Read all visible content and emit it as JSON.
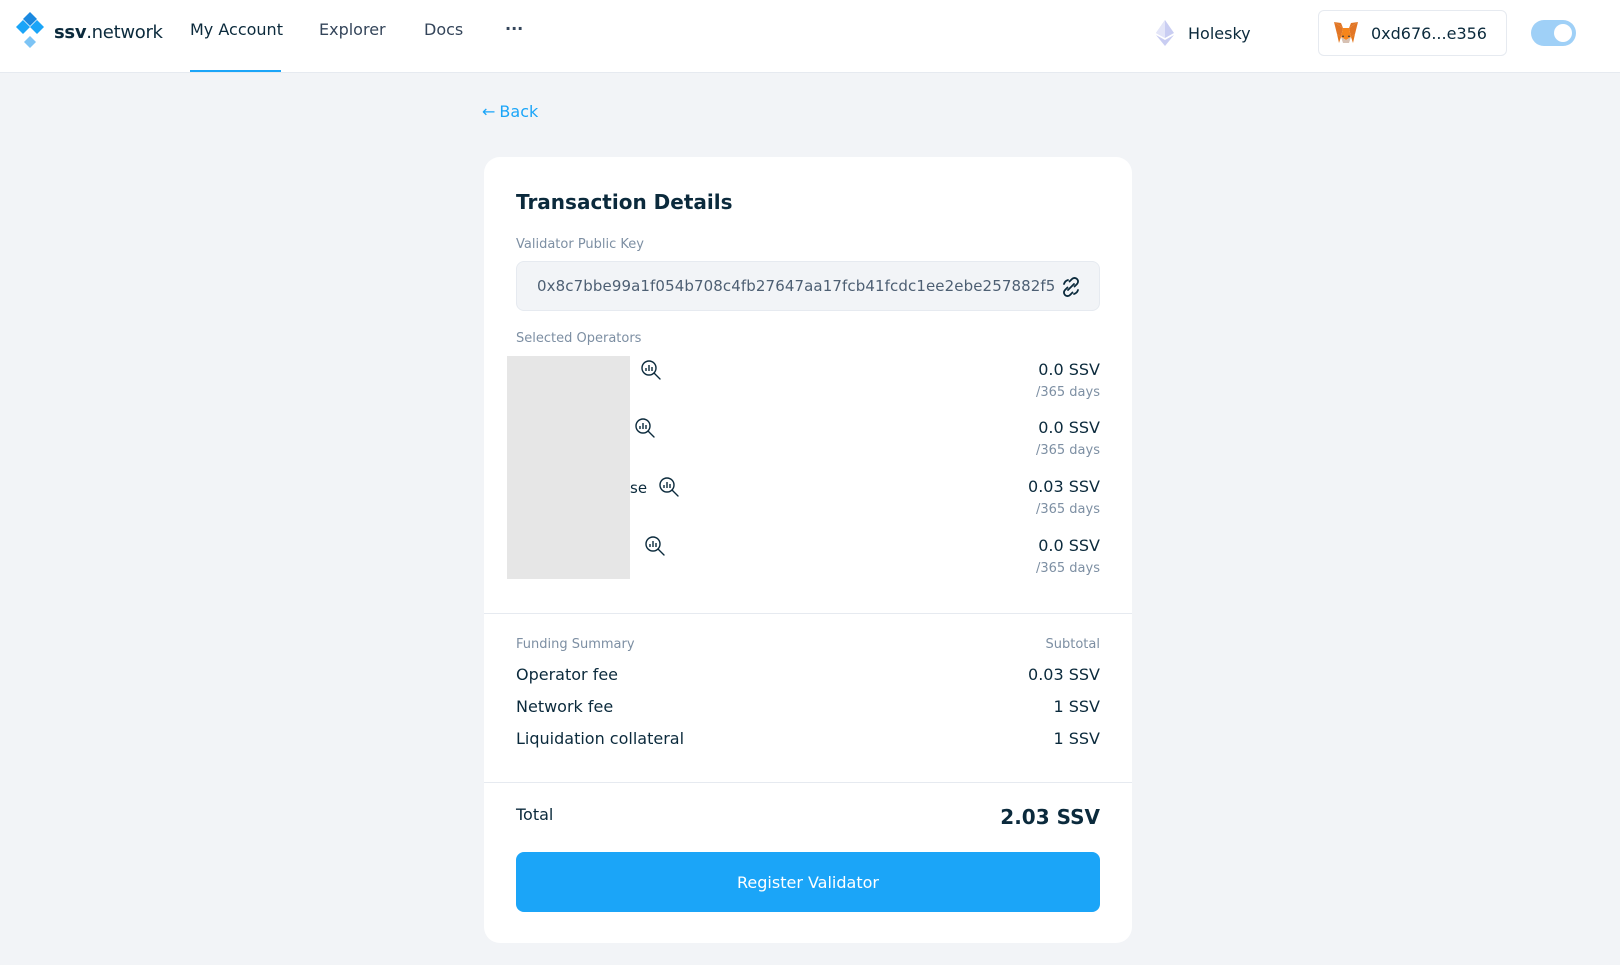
{
  "header": {
    "logo_bold": "ssv",
    "logo_rest": ".network",
    "nav": [
      {
        "label": "My Account",
        "active": true
      },
      {
        "label": "Explorer",
        "active": false
      },
      {
        "label": "Docs",
        "active": false
      },
      {
        "label": "···",
        "active": false
      }
    ],
    "network": {
      "label": "Holesky",
      "icon": "ethereum-icon"
    },
    "wallet": {
      "address": "0xd676...e356",
      "icon": "metamask-fox-icon"
    },
    "theme_toggle": {
      "on": true
    }
  },
  "back_label": "Back",
  "card": {
    "title": "Transaction Details",
    "pubkey_label": "Validator Public Key",
    "pubkey_value": "0x8c7bbe99a1f054b708c4fb27647aa17fcb41fcdc1ee2ebe257882f5",
    "operators_label": "Selected Operators",
    "operators": [
      {
        "name_visible": "",
        "fee": "0.0 SSV",
        "period": "/365 days"
      },
      {
        "name_visible": "",
        "fee": "0.0 SSV",
        "period": "/365 days"
      },
      {
        "name_visible": "se",
        "fee": "0.03 SSV",
        "period": "/365 days"
      },
      {
        "name_visible": "",
        "fee": "0.0 SSV",
        "period": "/365 days"
      }
    ],
    "funding_label": "Funding Summary",
    "subtotal_label": "Subtotal",
    "fees": [
      {
        "label": "Operator fee",
        "value": "0.03 SSV"
      },
      {
        "label": "Network fee",
        "value": "1 SSV"
      },
      {
        "label": "Liquidation collateral",
        "value": "1 SSV"
      }
    ],
    "total_label": "Total",
    "total_value": "2.03 SSV",
    "register_button": "Register Validator"
  },
  "colors": {
    "accent": "#1ba5f8",
    "page_bg": "#f2f4f7",
    "text_primary": "#0b2a3c",
    "text_muted": "#7d8fa3"
  }
}
